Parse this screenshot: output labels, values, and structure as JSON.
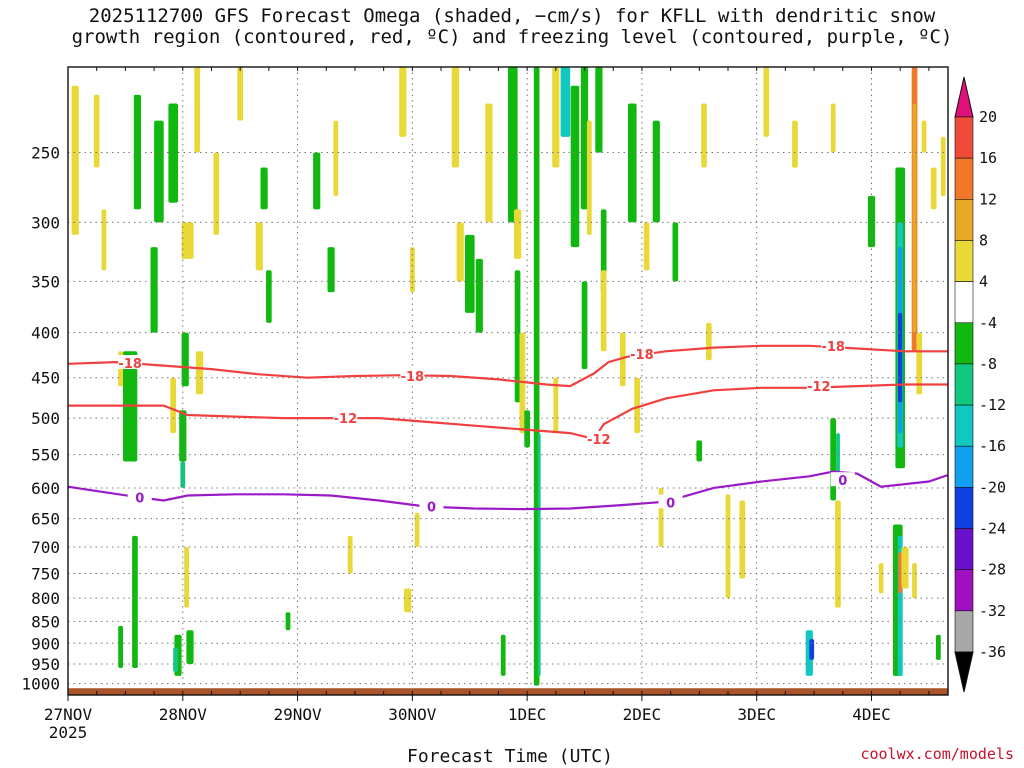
{
  "title_line1": "2025112700 GFS Forecast Omega (shaded, −cm/s) for KFLL with dendritic snow",
  "title_line2": "growth region (contoured, red, ºC) and freezing level (contoured, purple, ºC)",
  "credit": "coolwx.com/models",
  "colors": {
    "red_contour": "#f04040",
    "purple_contour": "#9a1ac8",
    "terrain": "#a9552a",
    "grid": "#777777"
  },
  "chart_data": {
    "type": "heatmap",
    "title": "2025112700 GFS Forecast Omega (shaded, −cm/s) for KFLL with dendritic snow growth region (contoured, red, ºC) and freezing level (contoured, purple, ºC)",
    "xlabel": "Forecast Time (UTC)",
    "ylabel": "",
    "x_ticks": [
      "27NOV",
      "28NOV",
      "29NOV",
      "30NOV",
      "1DEC",
      "2DEC",
      "3DEC",
      "4DEC"
    ],
    "x_tick_sublabel": "2025",
    "x_range_hours": [
      0,
      184
    ],
    "y_ticks": [
      250,
      300,
      350,
      400,
      450,
      500,
      550,
      600,
      650,
      700,
      750,
      800,
      850,
      900,
      950,
      1000
    ],
    "y_range_hpa": [
      200,
      1030
    ],
    "y_scale": "log",
    "grid": "dotted",
    "colorbar": {
      "labels": [
        "20",
        "16",
        "12",
        "8",
        "4",
        "-4",
        "-8",
        "-12",
        "-16",
        "-20",
        "-24",
        "-28",
        "-32",
        "-36"
      ],
      "colors": [
        "#e0107a",
        "#f04a3a",
        "#f07828",
        "#e8a828",
        "#e8d838",
        "#ffffff",
        "#10b810",
        "#10c880",
        "#10c8c0",
        "#10a0f0",
        "#1040e0",
        "#6a10c8",
        "#a010c0",
        "#a8a8a8",
        "#000000"
      ],
      "triangles": "both"
    },
    "contours": [
      {
        "name": "-18",
        "color": "#f04040",
        "points": [
          [
            0,
            434
          ],
          [
            10,
            432
          ],
          [
            20,
            436
          ],
          [
            30,
            440
          ],
          [
            40,
            446
          ],
          [
            50,
            450
          ],
          [
            60,
            448
          ],
          [
            70,
            447
          ],
          [
            80,
            448
          ],
          [
            90,
            452
          ],
          [
            100,
            458
          ],
          [
            105,
            460
          ],
          [
            110,
            445
          ],
          [
            113,
            432
          ],
          [
            117,
            426
          ],
          [
            125,
            420
          ],
          [
            135,
            416
          ],
          [
            145,
            414
          ],
          [
            155,
            414
          ],
          [
            165,
            417
          ],
          [
            175,
            420
          ],
          [
            184,
            420
          ]
        ],
        "labels": [
          [
            13,
            433
          ],
          [
            72,
            448
          ],
          [
            120,
            423
          ],
          [
            160,
            414
          ]
        ]
      },
      {
        "name": "-12",
        "color": "#f04040",
        "points": [
          [
            0,
            484
          ],
          [
            10,
            484
          ],
          [
            20,
            484
          ],
          [
            25,
            496
          ],
          [
            35,
            498
          ],
          [
            45,
            500
          ],
          [
            55,
            500
          ],
          [
            65,
            500
          ],
          [
            75,
            505
          ],
          [
            85,
            510
          ],
          [
            95,
            515
          ],
          [
            105,
            520
          ],
          [
            110,
            528
          ],
          [
            112,
            508
          ],
          [
            118,
            488
          ],
          [
            125,
            475
          ],
          [
            135,
            465
          ],
          [
            145,
            462
          ],
          [
            155,
            462
          ],
          [
            165,
            460
          ],
          [
            175,
            458
          ],
          [
            184,
            458
          ]
        ],
        "labels": [
          [
            58,
            500
          ],
          [
            111,
            528
          ],
          [
            157,
            460
          ]
        ]
      },
      {
        "name": "0",
        "color": "#9a1ac8",
        "points": [
          [
            0,
            598
          ],
          [
            6,
            605
          ],
          [
            15,
            615
          ],
          [
            20,
            620
          ],
          [
            25,
            612
          ],
          [
            35,
            610
          ],
          [
            45,
            610
          ],
          [
            55,
            612
          ],
          [
            65,
            620
          ],
          [
            75,
            630
          ],
          [
            85,
            633
          ],
          [
            95,
            634
          ],
          [
            105,
            633
          ],
          [
            115,
            628
          ],
          [
            125,
            622
          ],
          [
            135,
            600
          ],
          [
            145,
            590
          ],
          [
            155,
            582
          ],
          [
            160,
            575
          ],
          [
            165,
            578
          ],
          [
            170,
            598
          ],
          [
            180,
            590
          ],
          [
            184,
            580
          ]
        ],
        "labels": [
          [
            15,
            615
          ],
          [
            76,
            630
          ],
          [
            126,
            623
          ],
          [
            162,
            588
          ]
        ]
      }
    ]
  }
}
